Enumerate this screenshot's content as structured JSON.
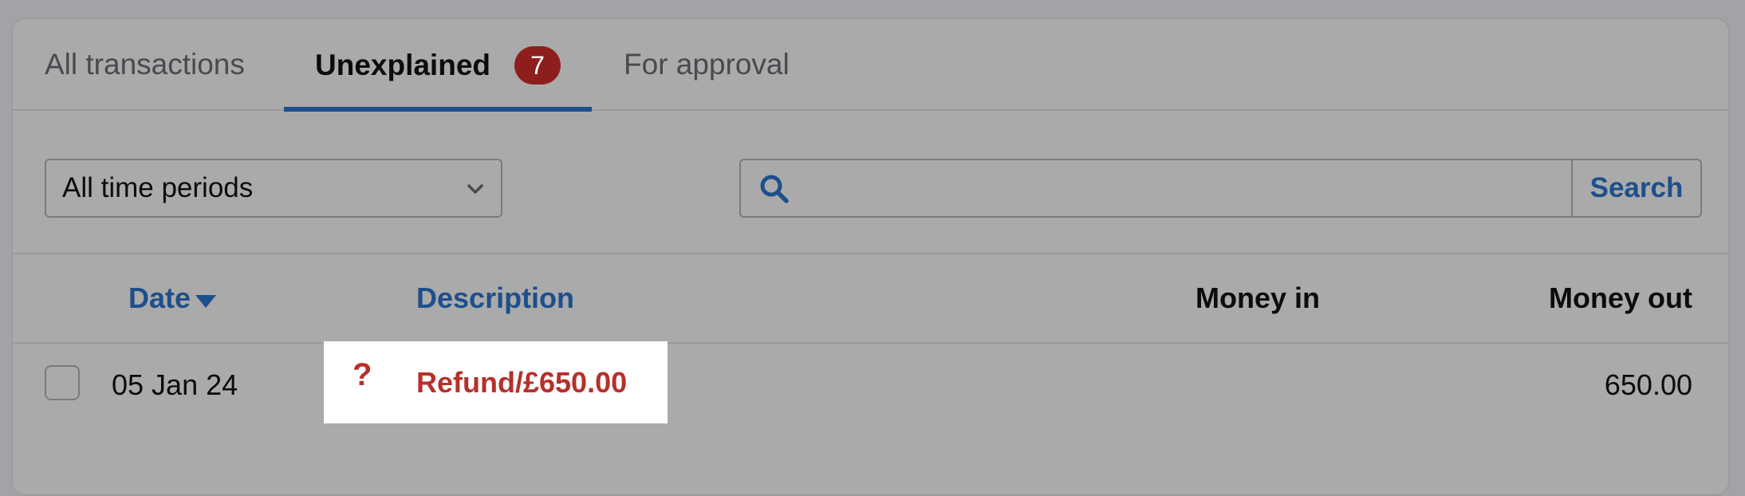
{
  "tabs": [
    {
      "label": "All transactions",
      "active": false
    },
    {
      "label": "Unexplained",
      "active": true,
      "badge": "7"
    },
    {
      "label": "For approval",
      "active": false
    }
  ],
  "filters": {
    "period_selected": "All time periods",
    "search_placeholder": "",
    "search_button": "Search"
  },
  "table": {
    "headers": {
      "date": "Date",
      "description": "Description",
      "money_in": "Money in",
      "money_out": "Money out"
    },
    "rows": [
      {
        "date": "05 Jan 24",
        "status_icon": "question-mark-icon",
        "description": "Refund/£650.00",
        "money_in": "",
        "money_out": "650.00"
      }
    ]
  },
  "colors": {
    "brand_blue": "#1d4f8c",
    "badge_red": "#8c1f1c",
    "warning_red": "#b5312a"
  }
}
